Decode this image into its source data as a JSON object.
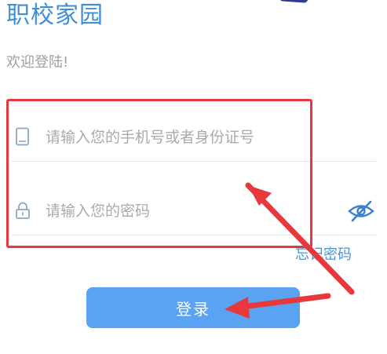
{
  "app": {
    "title": "职校家园",
    "welcome": "欢迎登陆!"
  },
  "form": {
    "phone_placeholder": "请输入您的手机号或者身份证号",
    "password_placeholder": "请输入您的密码",
    "forgot_label": "忘记密码",
    "login_label": "登录"
  },
  "icons": {
    "phone": "phone-icon",
    "lock": "lock-icon",
    "password_visibility": "eye-off-icon"
  },
  "colors": {
    "brand": "#3f8fd8",
    "button": "#5aa3f2",
    "annotation": "#e8383d"
  }
}
